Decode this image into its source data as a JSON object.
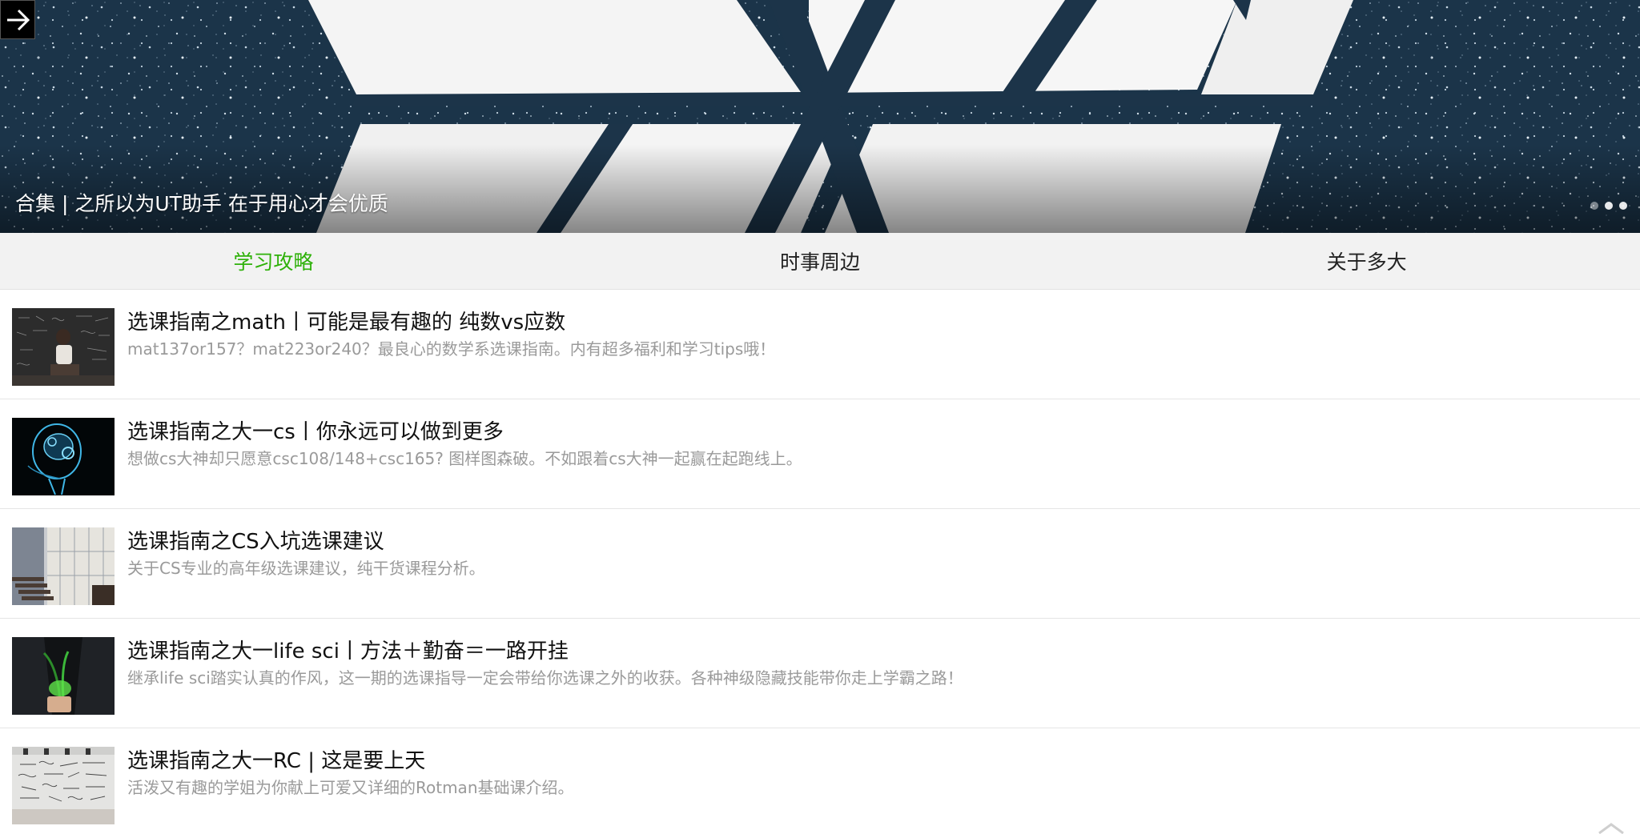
{
  "hero": {
    "caption": "合集 | 之所以为UT助手 在于用心才会优质",
    "back_icon": "arrow-right-icon",
    "slides": [
      {
        "active": false
      },
      {
        "active": true
      },
      {
        "active": true
      }
    ]
  },
  "tabs": [
    {
      "label": "学习攻略",
      "active": true
    },
    {
      "label": "时事周边",
      "active": false
    },
    {
      "label": "关于多大",
      "active": false
    }
  ],
  "colors": {
    "active_tab": "#2fb10a",
    "tab_bar_bg": "#f2f2f2",
    "description_text": "#9a9a9a"
  },
  "articles": [
    {
      "title": "选课指南之math丨可能是最有趣的 纯数vs应数",
      "description": "mat137or157？mat223or240？最良心的数学系选课指南。内有超多福利和学习tips哦！"
    },
    {
      "title": "选课指南之大一cs丨你永远可以做到更多",
      "description": "想做cs大神却只愿意csc108/148+csc165? 图样图森破。不如跟着cs大神一起赢在起跑线上。"
    },
    {
      "title": "选课指南之CS入坑选课建议",
      "description": "关于CS专业的高年级选课建议，纯干货课程分析。"
    },
    {
      "title": "选课指南之大一life sci丨方法＋勤奋＝一路开挂",
      "description": "继承life sci踏实认真的作风，这一期的选课指导一定会带给你选课之外的收获。各种神级隐藏技能带你走上学霸之路！"
    },
    {
      "title": "选课指南之大一RC | 这是要上天",
      "description": "活泼又有趣的学姐为你献上可爱又详细的Rotman基础课介绍。"
    }
  ]
}
